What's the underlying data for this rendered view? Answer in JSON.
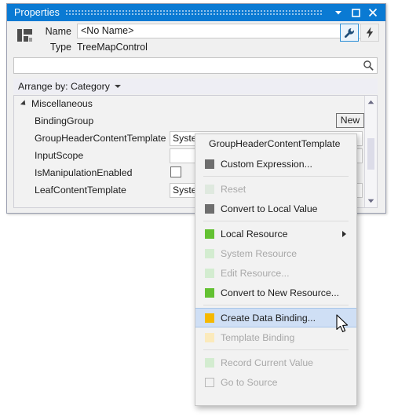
{
  "window": {
    "title": "Properties",
    "titlebar_buttons": [
      {
        "name": "dropdown",
        "glyph": "caret-down-icon"
      },
      {
        "name": "maximize",
        "glyph": "maximize-icon"
      },
      {
        "name": "close",
        "glyph": "close-icon"
      }
    ]
  },
  "header": {
    "name_label": "Name",
    "name_value": "<No Name>",
    "type_label": "Type",
    "type_value": "TreeMapControl",
    "properties_button_icon": "wrench-icon",
    "events_button_icon": "lightning-bolt-icon"
  },
  "search": {
    "value": "",
    "placeholder": "",
    "icon": "search-icon"
  },
  "arrange": {
    "label": "Arrange by: Category",
    "caret": "chevron-down-icon"
  },
  "grid": {
    "category": "Miscellaneous",
    "rows": [
      {
        "name": "BindingGroup",
        "value_type": "button",
        "value": "New"
      },
      {
        "name": "GroupHeaderContentTemplate",
        "value_type": "combo",
        "value": "System.Windows.DataTemplate"
      },
      {
        "name": "InputScope",
        "value_type": "combo",
        "value": ""
      },
      {
        "name": "IsManipulationEnabled",
        "value_type": "checkbox",
        "value": ""
      },
      {
        "name": "LeafContentTemplate",
        "value_type": "combo",
        "value": "System.Windows.DataTemplate"
      }
    ],
    "scrollbar": {
      "up_icon": "scroll-up-icon",
      "down_icon": "scroll-down-icon"
    }
  },
  "context_menu": {
    "title": "GroupHeaderContentTemplate",
    "items": [
      {
        "label": "Custom Expression...",
        "swatch": "#6e6e6e",
        "disabled": false,
        "highlighted": false,
        "submenu": false,
        "sep_after": true
      },
      {
        "label": "Reset",
        "swatch": "#dfe9df",
        "disabled": true,
        "highlighted": false,
        "submenu": false,
        "sep_after": false
      },
      {
        "label": "Convert to Local Value",
        "swatch": "#6e6e6e",
        "disabled": false,
        "highlighted": false,
        "submenu": false,
        "sep_after": true
      },
      {
        "label": "Local Resource",
        "swatch": "#63c132",
        "disabled": false,
        "highlighted": false,
        "submenu": true,
        "sep_after": false
      },
      {
        "label": "System Resource",
        "swatch": "#d3ecd0",
        "disabled": true,
        "highlighted": false,
        "submenu": false,
        "sep_after": false
      },
      {
        "label": "Edit Resource...",
        "swatch": "#d3ecd0",
        "disabled": true,
        "highlighted": false,
        "submenu": false,
        "sep_after": false
      },
      {
        "label": "Convert to New Resource...",
        "swatch": "#63c132",
        "disabled": false,
        "highlighted": false,
        "submenu": false,
        "sep_after": true
      },
      {
        "label": "Create Data Binding...",
        "swatch": "#f5b800",
        "disabled": false,
        "highlighted": true,
        "submenu": false,
        "sep_after": false
      },
      {
        "label": "Template Binding",
        "swatch": "#fbeabc",
        "disabled": true,
        "highlighted": false,
        "submenu": false,
        "sep_after": true
      },
      {
        "label": "Record Current Value",
        "swatch": "#d3ecd0",
        "disabled": true,
        "highlighted": false,
        "submenu": false,
        "sep_after": false
      },
      {
        "label": "Go to Source",
        "swatch": "hollow",
        "disabled": true,
        "highlighted": false,
        "submenu": false,
        "sep_after": false
      }
    ]
  },
  "colors": {
    "titlebar": "#0a7ad3",
    "highlight": "#cfdff5",
    "green": "#63c132",
    "amber": "#f5b800",
    "panel": "#f0f0f0"
  },
  "cursor": {
    "icon": "arrow-pointer"
  }
}
